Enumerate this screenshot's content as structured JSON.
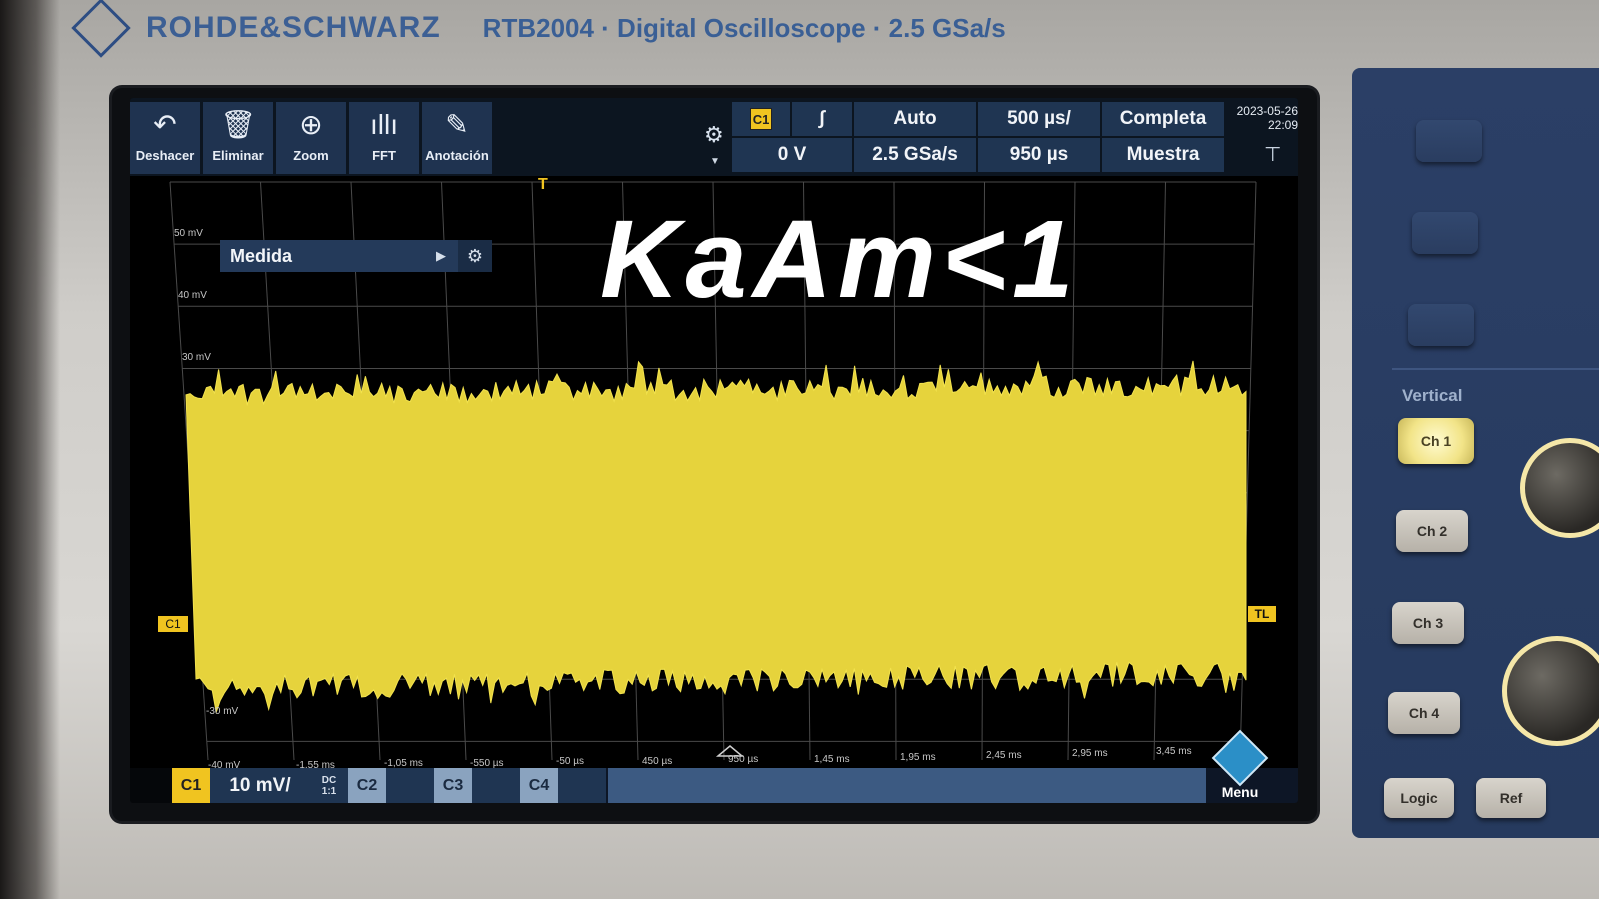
{
  "header": {
    "brand": "ROHDE&SCHWARZ",
    "model": "RTB2004 · Digital Oscilloscope · 2.5 GSa/s"
  },
  "toolbar": {
    "buttons": [
      {
        "label": "Deshacer",
        "icon": "undo-icon"
      },
      {
        "label": "Eliminar",
        "icon": "trash-icon"
      },
      {
        "label": "Zoom",
        "icon": "zoom-icon"
      },
      {
        "label": "FFT",
        "icon": "fft-icon"
      },
      {
        "label": "Anotación",
        "icon": "pencil-icon"
      }
    ]
  },
  "status": {
    "trigger_source": "C1",
    "trigger_level": "0 V",
    "trigger_mode": "Auto",
    "sample_rate": "2.5 GSa/s",
    "time_scale": "500 µs/",
    "time_offset": "950 µs",
    "acq_mode": "Completa",
    "acq_type": "Muestra",
    "date": "2023-05-26",
    "time": "22:09"
  },
  "measure_panel": {
    "label": "Medida"
  },
  "annotation": "KaAm<1",
  "y_labels": [
    "50 mV",
    "40 mV",
    "30 mV",
    "-30 mV",
    "-40 mV"
  ],
  "x_labels": [
    "-1,55 ms",
    "-1,05 ms",
    "-550 µs",
    "-50 µs",
    "450 µs",
    "950 µs",
    "1,45 ms",
    "1,95 ms",
    "2,45 ms",
    "2,95 ms",
    "3,45 ms"
  ],
  "markers": {
    "channel": "C1",
    "trigger_level": "TL",
    "trigger_pos": "T"
  },
  "channel_bar": {
    "c1": "C1",
    "c1_scale": "10 mV/",
    "c1_coupling": "DC",
    "c1_ratio": "1:1",
    "c2": "C2",
    "c3": "C3",
    "c4": "C4",
    "menu": "Menu"
  },
  "right_panel": {
    "section": "Vertical",
    "buttons": [
      "Ch 1",
      "Ch 2",
      "Ch 3",
      "Ch 4",
      "Logic",
      "Ref"
    ]
  },
  "colors": {
    "trace": "#e6d33c",
    "panel": "#263a5e",
    "accent": "#f0c420"
  }
}
